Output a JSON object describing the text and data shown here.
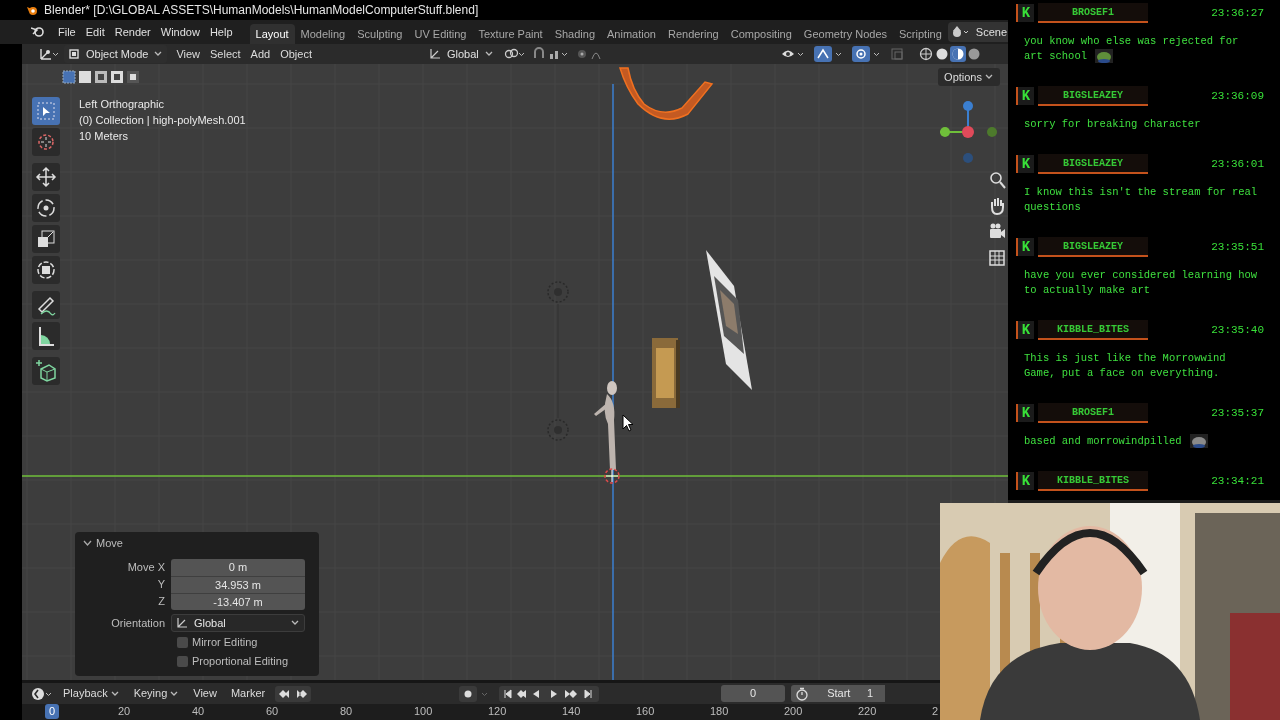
{
  "window": {
    "title": "Blender* [D:\\GLOBAL ASSETS\\HumanModels\\HumanModelComputerStuff.blend]"
  },
  "menu": [
    "File",
    "Edit",
    "Render",
    "Window",
    "Help"
  ],
  "workspace_tabs": [
    {
      "label": "Layout",
      "selected": true
    },
    {
      "label": "Modeling",
      "selected": false
    },
    {
      "label": "Sculpting",
      "selected": false
    },
    {
      "label": "UV Editing",
      "selected": false
    },
    {
      "label": "Texture Paint",
      "selected": false
    },
    {
      "label": "Shading",
      "selected": false
    },
    {
      "label": "Animation",
      "selected": false
    },
    {
      "label": "Rendering",
      "selected": false
    },
    {
      "label": "Compositing",
      "selected": false
    },
    {
      "label": "Geometry Nodes",
      "selected": false
    },
    {
      "label": "Scripting",
      "selected": false
    }
  ],
  "scene": "Scene",
  "header": {
    "mode": "Object Mode",
    "menus": [
      "View",
      "Select",
      "Add",
      "Object"
    ],
    "orientation": "Global",
    "options": "Options"
  },
  "viewport": {
    "info": [
      "Left Orthographic",
      "(0) Collection | high-polyMesh.001",
      "10 Meters"
    ]
  },
  "toolbar": [
    {
      "kind": "select",
      "selected": true
    },
    {
      "kind": "cursor",
      "selected": false
    },
    {
      "kind": "move",
      "selected": false
    },
    {
      "kind": "rotate",
      "selected": false
    },
    {
      "kind": "scale",
      "selected": false
    },
    {
      "kind": "transform",
      "selected": false
    },
    {
      "kind": "annotate",
      "selected": false
    },
    {
      "kind": "measure",
      "selected": false
    },
    {
      "kind": "add_cube",
      "selected": false
    }
  ],
  "operator_panel": {
    "title": "Move",
    "expanded": true,
    "fields": [
      {
        "label": "Move X",
        "value": "0 m"
      },
      {
        "label": "Y",
        "value": "34.953 m"
      },
      {
        "label": "Z",
        "value": "-13.407 m"
      }
    ],
    "orientation_label": "Orientation",
    "orientation": "Global",
    "checks": [
      {
        "label": "Mirror Editing",
        "checked": false
      },
      {
        "label": "Proportional Editing",
        "checked": false
      }
    ]
  },
  "timeline": {
    "menus": [
      "Playback",
      "Keying",
      "View",
      "Marker"
    ],
    "current_frame": "0",
    "start_label": "Start",
    "start": "1",
    "ruler": [
      {
        "label": "0",
        "selected": true
      },
      {
        "label": "20",
        "selected": false
      },
      {
        "label": "40",
        "selected": false
      },
      {
        "label": "60",
        "selected": false
      },
      {
        "label": "80",
        "selected": false
      },
      {
        "label": "100",
        "selected": false
      },
      {
        "label": "120",
        "selected": false
      },
      {
        "label": "140",
        "selected": false
      },
      {
        "label": "160",
        "selected": false
      },
      {
        "label": "180",
        "selected": false
      },
      {
        "label": "200",
        "selected": false
      },
      {
        "label": "220",
        "selected": false
      },
      {
        "label": "2",
        "selected": false
      }
    ]
  },
  "chat": [
    {
      "badge": "K",
      "user": "BROSEF1",
      "time": "23:36:27",
      "message": "you know who else was rejected for art school",
      "emote": {
        "color": "#5f8f3a"
      }
    },
    {
      "badge": "K",
      "user": "BIGSLEAZEY",
      "time": "23:36:09",
      "message": "sorry for breaking character"
    },
    {
      "badge": "K",
      "user": "BIGSLEAZEY",
      "time": "23:36:01",
      "message": "I know this isn't the stream for real questions"
    },
    {
      "badge": "K",
      "user": "BIGSLEAZEY",
      "time": "23:35:51",
      "message": "have you ever considered learning how to actually make art"
    },
    {
      "badge": "K",
      "user": "KIBBLE_BITES",
      "time": "23:35:40",
      "message": "This is just like the Morrowwind Game, put a face on everything."
    },
    {
      "badge": "K",
      "user": "BROSEF1",
      "time": "23:35:37",
      "message": "based and morrowindpilled",
      "emote": {
        "color": "#8a8a8a"
      }
    },
    {
      "badge": "K",
      "user": "KIBBLE_BITES",
      "time": "23:34:21"
    }
  ]
}
